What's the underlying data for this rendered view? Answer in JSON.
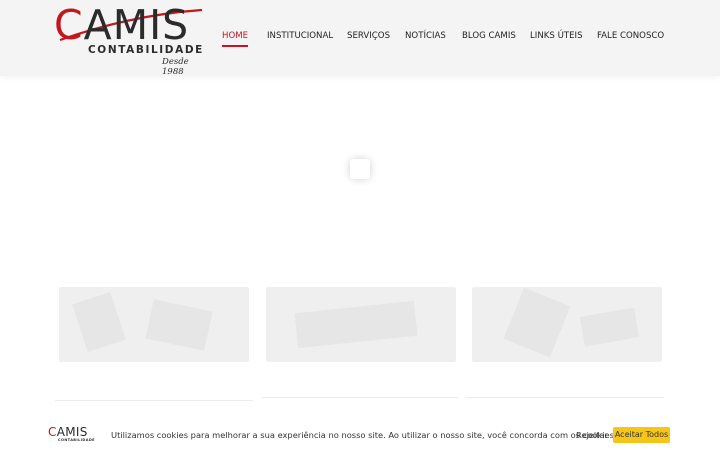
{
  "logo": {
    "first_letter": "C",
    "rest": "AMIS",
    "subtitle": "CONTABILIDADE",
    "since": "Desde 1988"
  },
  "nav": {
    "items": [
      {
        "label": "HOME",
        "active": true
      },
      {
        "label": "INSTITUCIONAL",
        "active": false
      },
      {
        "label": "SERVIÇOS",
        "active": false
      },
      {
        "label": "NOTÍCIAS",
        "active": false
      },
      {
        "label": "BLOG CAMIS",
        "active": false
      },
      {
        "label": "LINKS ÚTEIS",
        "active": false
      },
      {
        "label": "FALE CONOSCO",
        "active": false
      }
    ]
  },
  "colors": {
    "brand_red": "#c4161c",
    "accept_yellow": "#f5c518",
    "header_bg": "#f4f4f4"
  },
  "cookie": {
    "logo_first": "C",
    "logo_rest": "AMIS",
    "logo_sub": "CONTABILIDADE",
    "message": "Utilizamos cookies para melhorar a sua experiência no nosso site. Ao utilizar o nosso site, você concorda com os cookies.",
    "reject_label": "Rejeitar",
    "accept_label": "Aceitar Todos"
  }
}
